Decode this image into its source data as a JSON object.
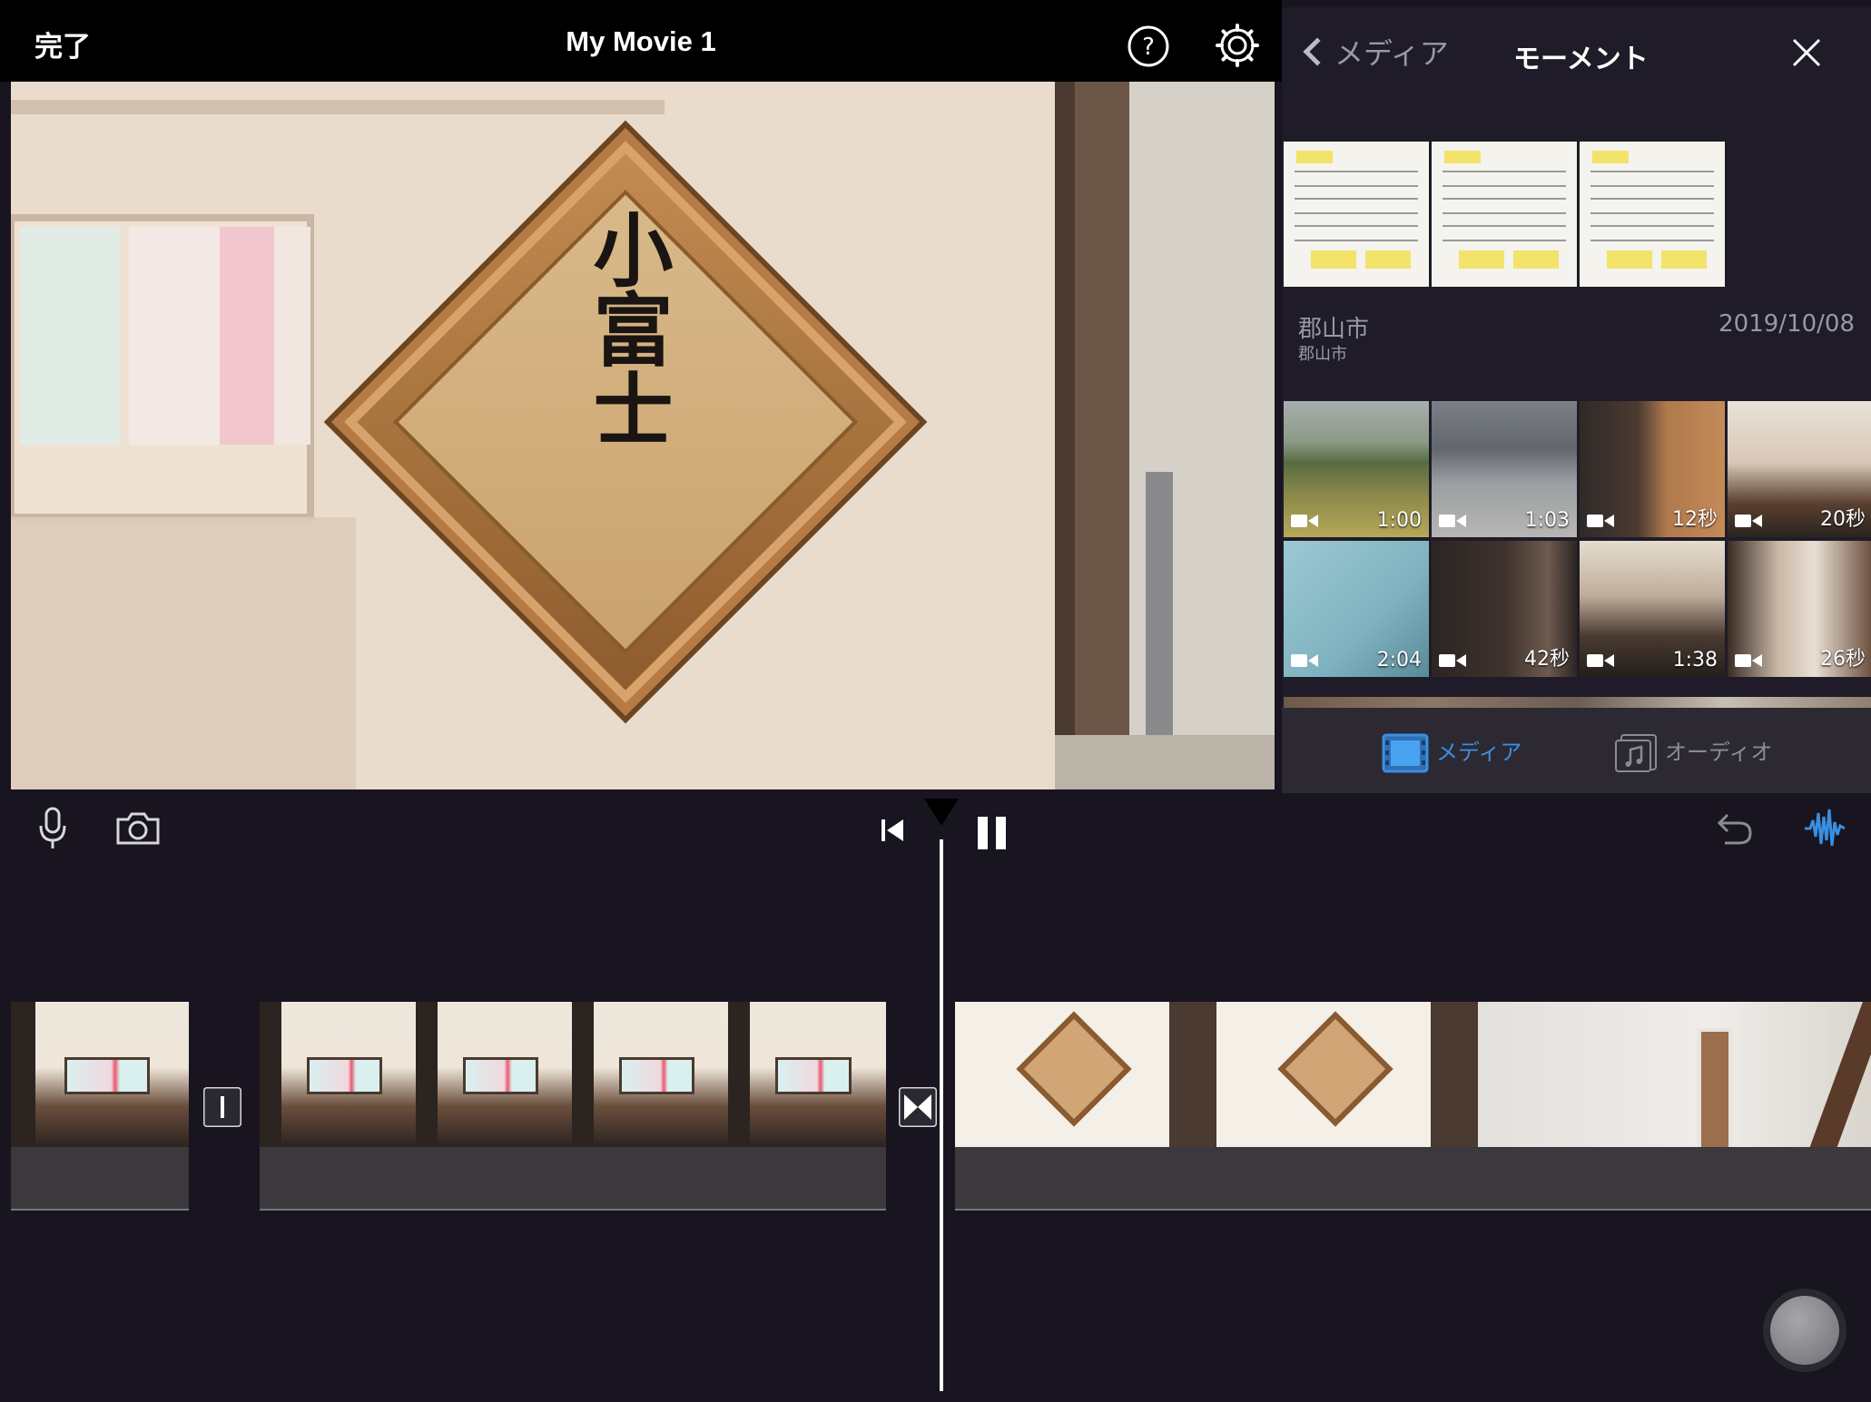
{
  "topbar": {
    "done_label": "完了",
    "title": "My Movie 1"
  },
  "viewer": {
    "sign_text": "小富士"
  },
  "browser": {
    "back_label": "メディア",
    "title": "モーメント",
    "moment": {
      "location": "郡山市",
      "sublocation": "郡山市",
      "date": "2019/10/08"
    },
    "media": [
      {
        "duration": "1:00"
      },
      {
        "duration": "1:03"
      },
      {
        "duration": "12秒"
      },
      {
        "duration": "20秒"
      },
      {
        "duration": "2:04"
      },
      {
        "duration": "42秒"
      },
      {
        "duration": "1:38"
      },
      {
        "duration": "26秒"
      }
    ],
    "tabs": {
      "media_label": "メディア",
      "audio_label": "オーディオ"
    }
  },
  "colors": {
    "accent": "#3a8fe0",
    "background": "#181420",
    "panel": "#1f1b28"
  },
  "icons": [
    "help-icon",
    "gear-icon",
    "chevron-left-icon",
    "close-icon",
    "video-camera-icon",
    "film-strip-icon",
    "music-note-icon",
    "microphone-icon",
    "camera-icon",
    "skip-to-start-icon",
    "pause-icon",
    "undo-icon",
    "waveform-icon",
    "transition-icon",
    "record-icon"
  ]
}
